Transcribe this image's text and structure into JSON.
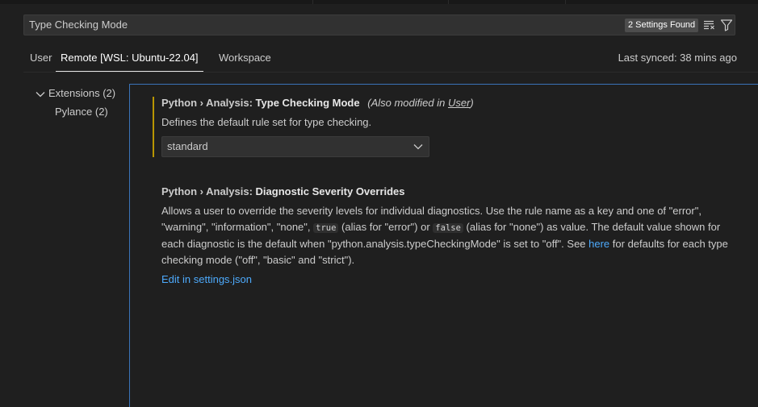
{
  "search": {
    "value": "Type Checking Mode",
    "results_badge": "2 Settings Found"
  },
  "tabs": {
    "user": "User",
    "remote": "Remote [WSL: Ubuntu-22.04]",
    "workspace": "Workspace"
  },
  "last_synced": "Last synced: 38 mins ago",
  "toc": {
    "extensions": "Extensions (2)",
    "pylance": "Pylance (2)"
  },
  "setting_type_checking": {
    "category": "Python › Analysis: ",
    "name": "Type Checking Mode",
    "modified_prefix": "(Also modified in ",
    "modified_link": "User",
    "modified_suffix": ")",
    "description": "Defines the default rule set for type checking.",
    "selected_value": "standard"
  },
  "setting_diagnostic": {
    "category": "Python › Analysis: ",
    "name": "Diagnostic Severity Overrides",
    "desc_part1": "Allows a user to override the severity levels for individual diagnostics. Use the rule name as a key and one of \"error\", \"warning\", \"information\", \"none\", ",
    "code_true": "true",
    "desc_part2": " (alias for \"error\") or ",
    "code_false": "false",
    "desc_part3": " (alias for \"none\") as value. The default value shown for each diagnostic is the default when \"python.analysis.typeCheckingMode\" is set to \"off\". See ",
    "link_here": "here",
    "desc_part4": " for defaults for each type checking mode (\"off\", \"basic\" and \"strict\").",
    "edit_link": "Edit in settings.json"
  },
  "colors": {
    "accent_link": "#4daafc",
    "modified_bar": "#b89500",
    "focus_border": "#3a73b8"
  }
}
